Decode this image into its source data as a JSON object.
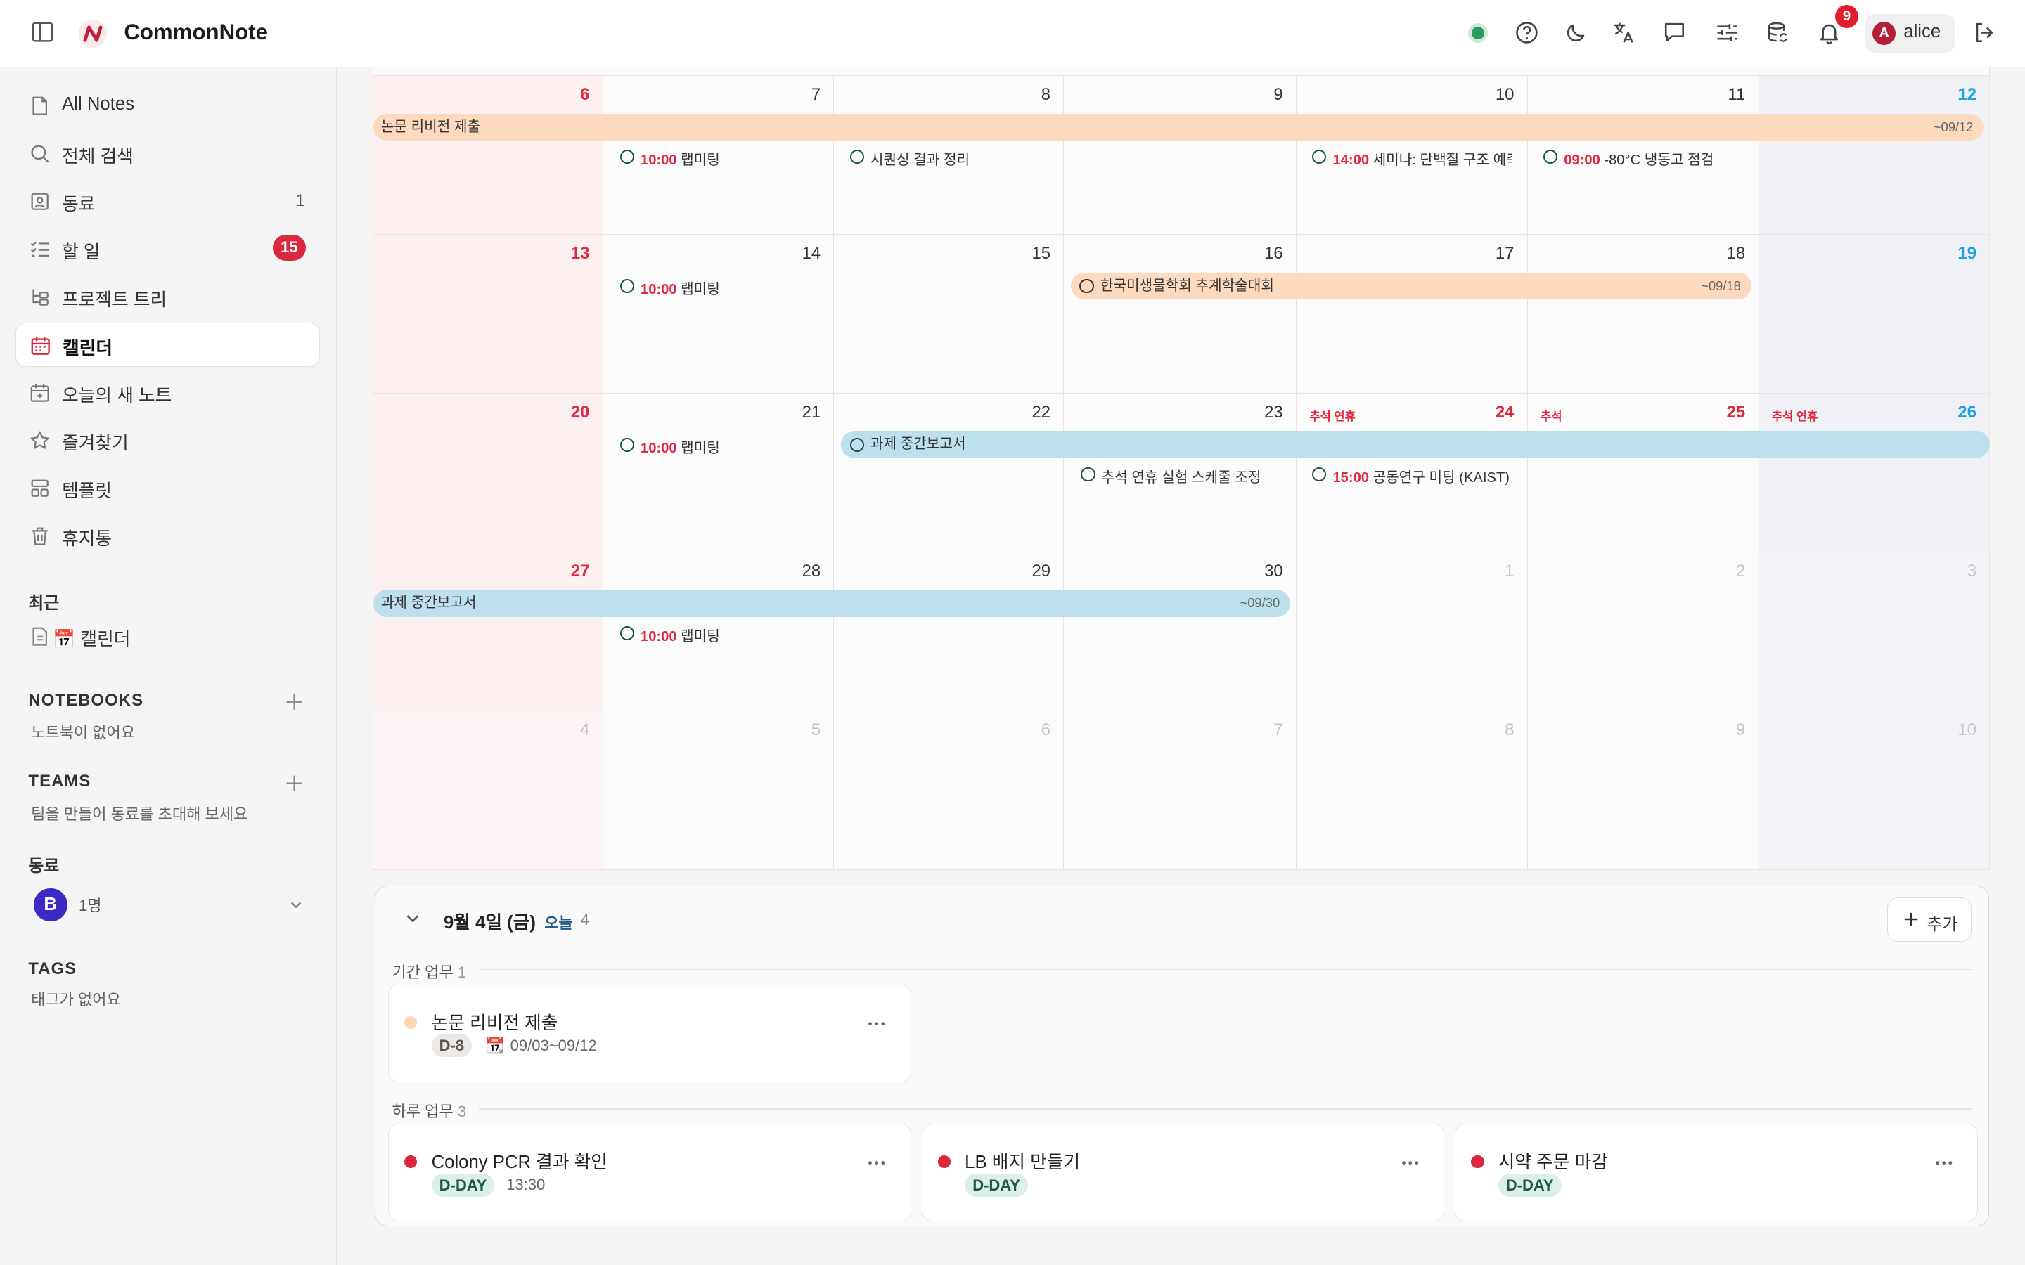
{
  "app": {
    "name": "CommonNote"
  },
  "header": {
    "notifications_count": "9",
    "user_initial": "A",
    "user_name": "alice",
    "status_color": "#2a9a5a"
  },
  "sidebar": {
    "items": [
      {
        "label": "All Notes",
        "icon": "file-icon"
      },
      {
        "label": "전체 검색",
        "icon": "search-icon"
      },
      {
        "label": "동료",
        "icon": "contact-icon",
        "count": "1"
      },
      {
        "label": "할 일",
        "icon": "checklist-icon",
        "badge": "15"
      },
      {
        "label": "프로젝트 트리",
        "icon": "tree-icon"
      },
      {
        "label": "캘린더",
        "icon": "calendar-icon",
        "active": true
      },
      {
        "label": "오늘의 새 노트",
        "icon": "calendar-plus-icon"
      },
      {
        "label": "즐겨찾기",
        "icon": "star-icon"
      },
      {
        "label": "템플릿",
        "icon": "template-icon"
      },
      {
        "label": "휴지통",
        "icon": "trash-icon"
      }
    ],
    "recent": {
      "title": "최근",
      "items": [
        "📅 캘린더"
      ]
    },
    "notebooks": {
      "title": "NOTEBOOKS",
      "empty": "노트북이 없어요"
    },
    "teams": {
      "title": "TEAMS",
      "empty": "팀을 만들어 동료를 초대해 보세요"
    },
    "colleagues": {
      "title": "동료",
      "avatar": "B",
      "count_label": "1명"
    },
    "tags": {
      "title": "TAGS",
      "empty": "태그가 없어요"
    }
  },
  "calendar": {
    "weeks": [
      {
        "days": [
          "6",
          "7",
          "8",
          "9",
          "10",
          "11",
          "12"
        ]
      },
      {
        "days": [
          "13",
          "14",
          "15",
          "16",
          "17",
          "18",
          "19"
        ]
      },
      {
        "days": [
          "20",
          "21",
          "22",
          "23",
          "24",
          "25",
          "26"
        ]
      },
      {
        "days": [
          "27",
          "28",
          "29",
          "30",
          "1",
          "2",
          "3"
        ]
      },
      {
        "days": [
          "4",
          "5",
          "6",
          "7",
          "8",
          "9",
          "10"
        ]
      }
    ],
    "holidays": [
      {
        "label": "추석 연휴"
      },
      {
        "label": "추석"
      },
      {
        "label": "추석 연휴"
      }
    ],
    "bars": [
      {
        "title": "논문 리비전 제출",
        "end": "~09/12",
        "color": "#fdd9bd"
      },
      {
        "title": "한국미생물학회 추계학술대회",
        "end": "~09/18",
        "color": "#fdd9bd"
      },
      {
        "title": "과제 중간보고서",
        "end": "",
        "color": "#bde0ee"
      },
      {
        "title": "과제 중간보고서",
        "end": "~09/30",
        "color": "#bde0ee"
      }
    ],
    "events": [
      {
        "time": "10:00",
        "title": "랩미팅"
      },
      {
        "time": "",
        "title": "시퀀싱 결과 정리"
      },
      {
        "time": "14:00",
        "title": "세미나: 단백질 구조 예측"
      },
      {
        "time": "09:00",
        "title": "-80°C 냉동고 점검"
      },
      {
        "time": "10:00",
        "title": "랩미팅"
      },
      {
        "time": "10:00",
        "title": "랩미팅"
      },
      {
        "time": "",
        "title": "추석 연휴 실험 스케줄 조정"
      },
      {
        "time": "15:00",
        "title": "공동연구 미팅 (KAIST)"
      },
      {
        "time": "10:00",
        "title": "랩미팅"
      }
    ]
  },
  "day_panel": {
    "title": "9월 4일 (금)",
    "today_label": "오늘",
    "count": "4",
    "add_label": "추가",
    "period_group": {
      "label": "기간 업무",
      "count": "1"
    },
    "period_tasks": [
      {
        "title": "논문 리비전 제출",
        "tag": "D-8",
        "date_icon": "📆",
        "range": "09/03~09/12",
        "dot_color": "#fbd6b5"
      }
    ],
    "day_group": {
      "label": "하루 업무",
      "count": "3"
    },
    "day_tasks": [
      {
        "title": "Colony PCR 결과 확인",
        "tag": "D-DAY",
        "time": "13:30",
        "dot_color": "#d9283f"
      },
      {
        "title": "LB 배지 만들기",
        "tag": "D-DAY",
        "dot_color": "#d9283f"
      },
      {
        "title": "시약 주문 마감",
        "tag": "D-DAY",
        "dot_color": "#d9283f"
      }
    ]
  }
}
